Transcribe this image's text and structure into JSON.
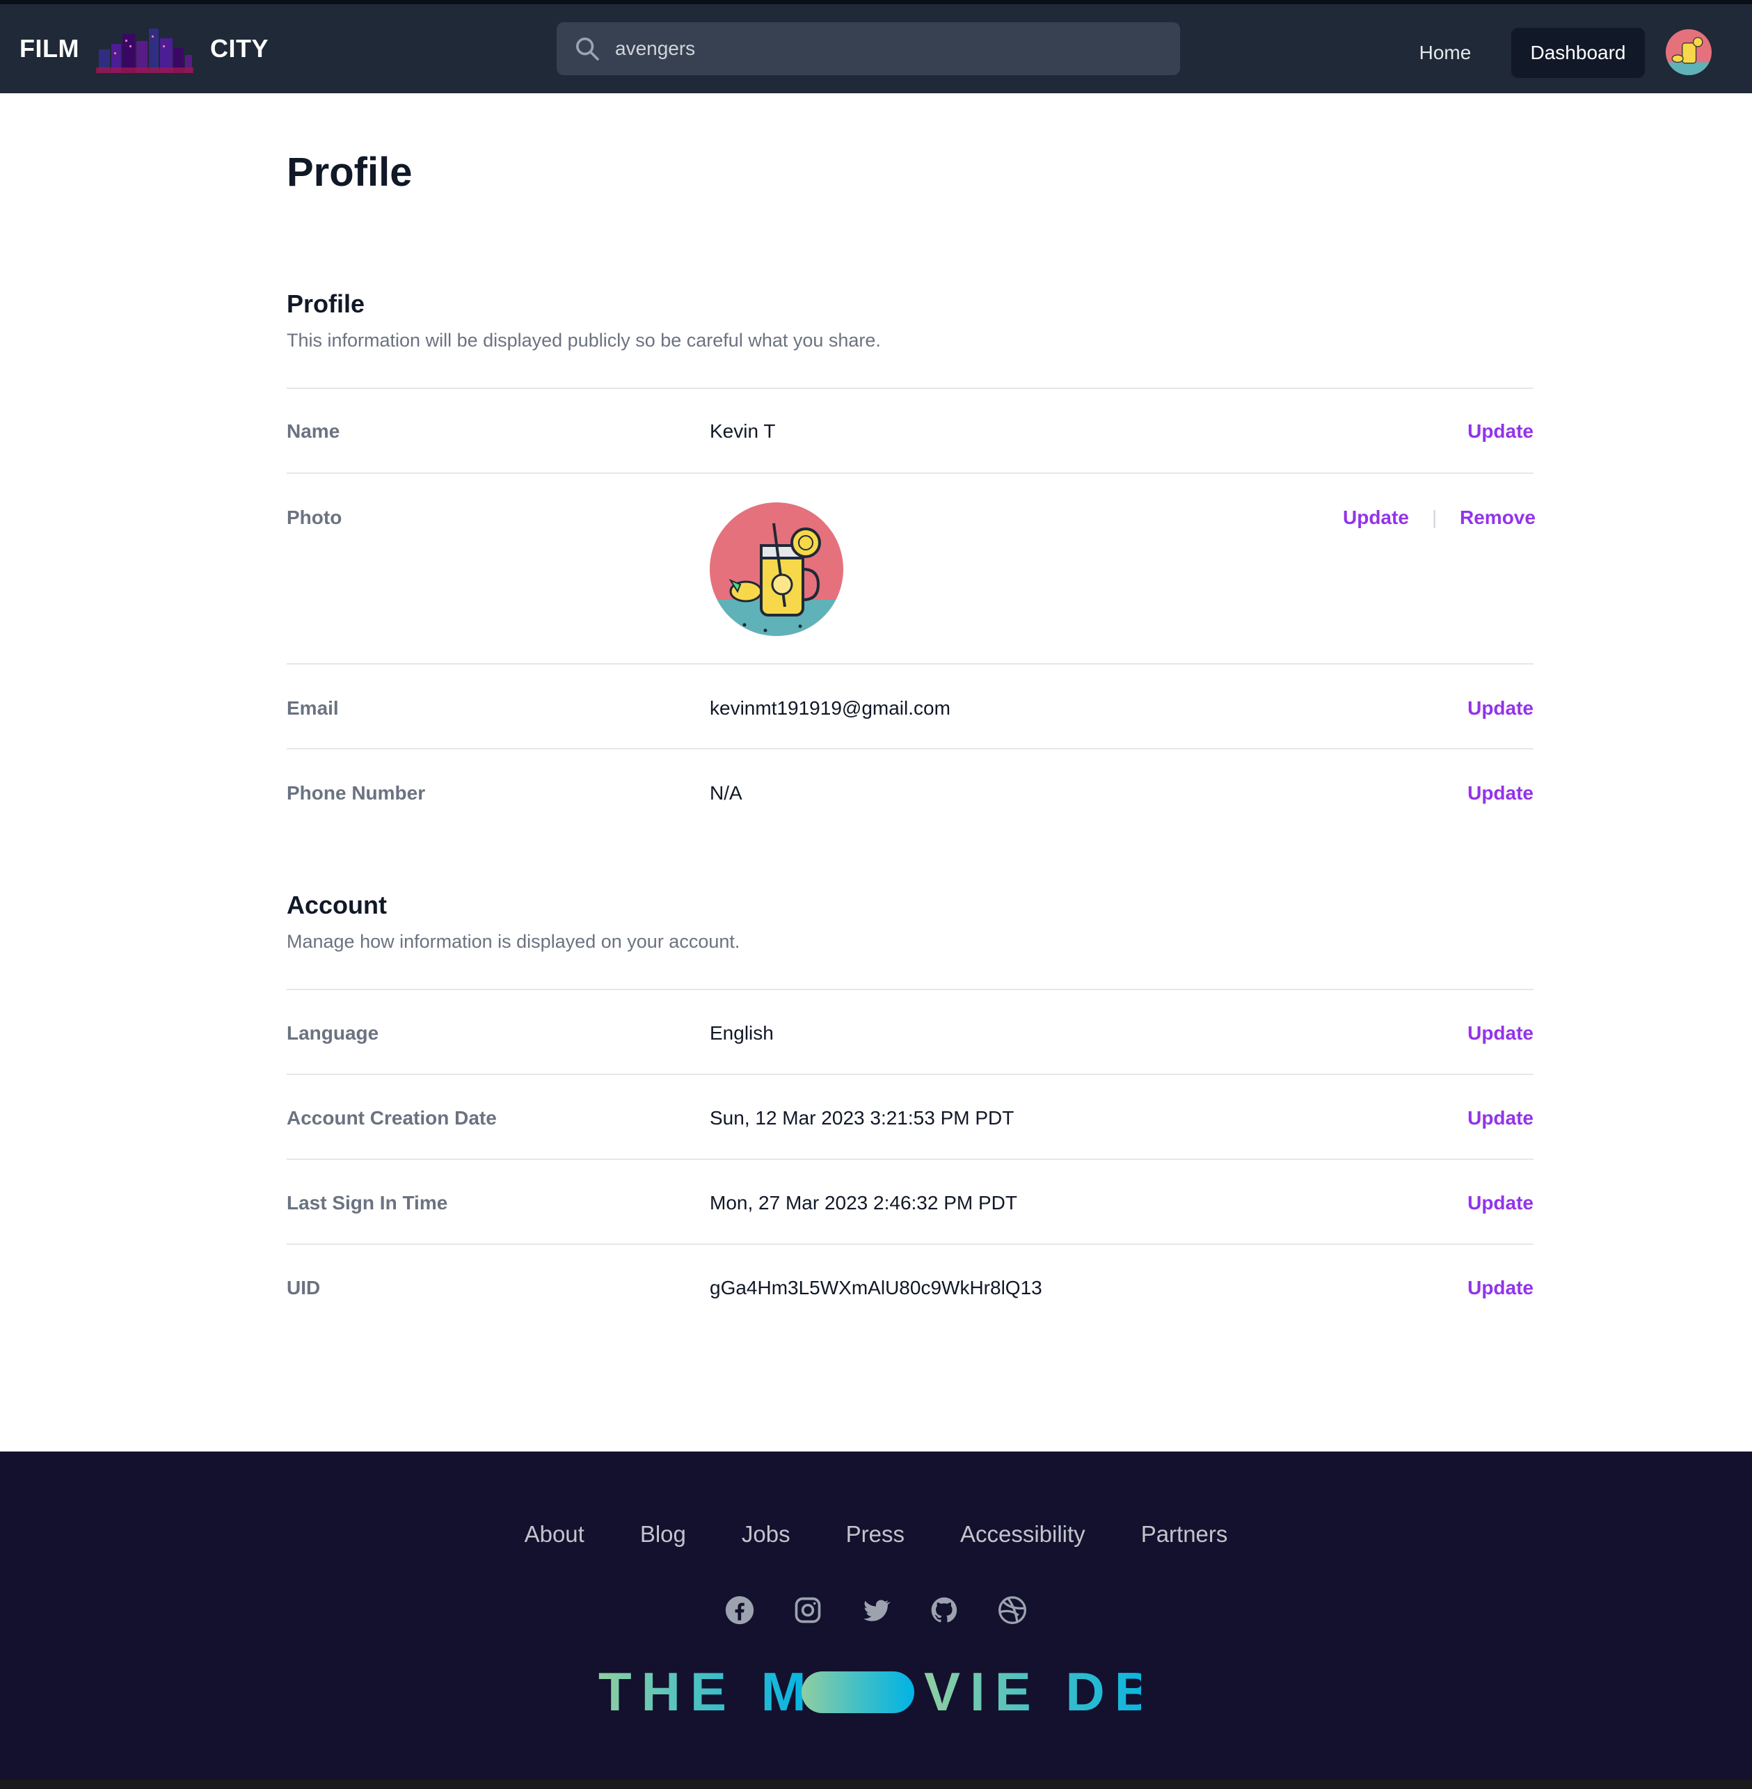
{
  "nav": {
    "brand_left": "FILM",
    "brand_right": "CITY",
    "search_value": "avengers",
    "home_label": "Home",
    "dashboard_label": "Dashboard"
  },
  "page": {
    "title": "Profile"
  },
  "profile_section": {
    "title": "Profile",
    "description": "This information will be displayed publicly so be careful what you share.",
    "rows": [
      {
        "label": "Name",
        "value": "Kevin T",
        "action": "Update"
      },
      {
        "label": "Photo",
        "action_update": "Update",
        "separator": "|",
        "action_remove": "Remove"
      },
      {
        "label": "Email",
        "value": "kevinmt191919@gmail.com",
        "action": "Update"
      },
      {
        "label": "Phone Number",
        "value": "N/A",
        "action": "Update"
      }
    ]
  },
  "account_section": {
    "title": "Account",
    "description": "Manage how information is displayed on your account.",
    "rows": [
      {
        "label": "Language",
        "value": "English",
        "action": "Update"
      },
      {
        "label": "Account Creation Date",
        "value": "Sun, 12 Mar 2023 3:21:53 PM PDT",
        "action": "Update"
      },
      {
        "label": "Last Sign In Time",
        "value": "Mon, 27 Mar 2023 2:46:32 PM PDT",
        "action": "Update"
      },
      {
        "label": "UID",
        "value": "gGa4Hm3L5WXmAlU80c9WkHr8lQ13",
        "action": "Update"
      }
    ]
  },
  "footer": {
    "links": [
      "About",
      "Blog",
      "Jobs",
      "Press",
      "Accessibility",
      "Partners"
    ],
    "socials": [
      "facebook-icon",
      "instagram-icon",
      "twitter-icon",
      "github-icon",
      "dribbble-icon"
    ],
    "logo_text": "THE MOVIE DB"
  },
  "colors": {
    "nav_bg": "#1f2937",
    "accent": "#9333ea",
    "footer_bg": "#13112e"
  }
}
